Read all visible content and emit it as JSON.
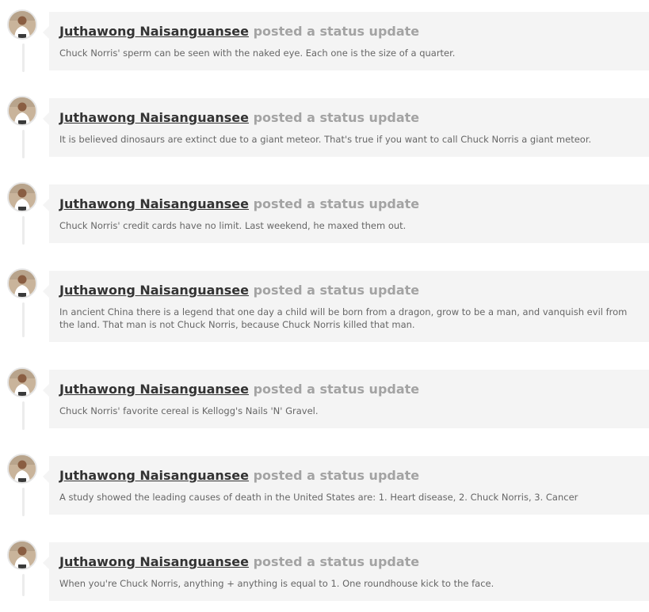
{
  "feed": {
    "items": [
      {
        "author": "Juthawong Naisanguansee",
        "action": "posted a status update",
        "text": "Chuck Norris' sperm can be seen with the naked eye. Each one is the size of a quarter."
      },
      {
        "author": "Juthawong Naisanguansee",
        "action": "posted a status update",
        "text": "It is believed dinosaurs are extinct due to a giant meteor. That's true if you want to call Chuck Norris a giant meteor."
      },
      {
        "author": "Juthawong Naisanguansee",
        "action": "posted a status update",
        "text": "Chuck Norris' credit cards have no limit. Last weekend, he maxed them out."
      },
      {
        "author": "Juthawong Naisanguansee",
        "action": "posted a status update",
        "text": "In ancient China there is a legend that one day a child will be born from a dragon, grow to be a man, and vanquish evil from the land. That man is not Chuck Norris, because Chuck Norris killed that man."
      },
      {
        "author": "Juthawong Naisanguansee",
        "action": "posted a status update",
        "text": "Chuck Norris' favorite cereal is Kellogg's Nails 'N' Gravel."
      },
      {
        "author": "Juthawong Naisanguansee",
        "action": "posted a status update",
        "text": "A study showed the leading causes of death in the United States are: 1. Heart disease, 2. Chuck Norris, 3. Cancer"
      },
      {
        "author": "Juthawong Naisanguansee",
        "action": "posted a status update",
        "text": "When you're Chuck Norris, anything + anything is equal to 1. One roundhouse kick to the face."
      }
    ]
  },
  "colors": {
    "card_bg": "#f4f4f4",
    "author": "#333333",
    "action": "#a3a3a3",
    "body_text": "#666666"
  }
}
